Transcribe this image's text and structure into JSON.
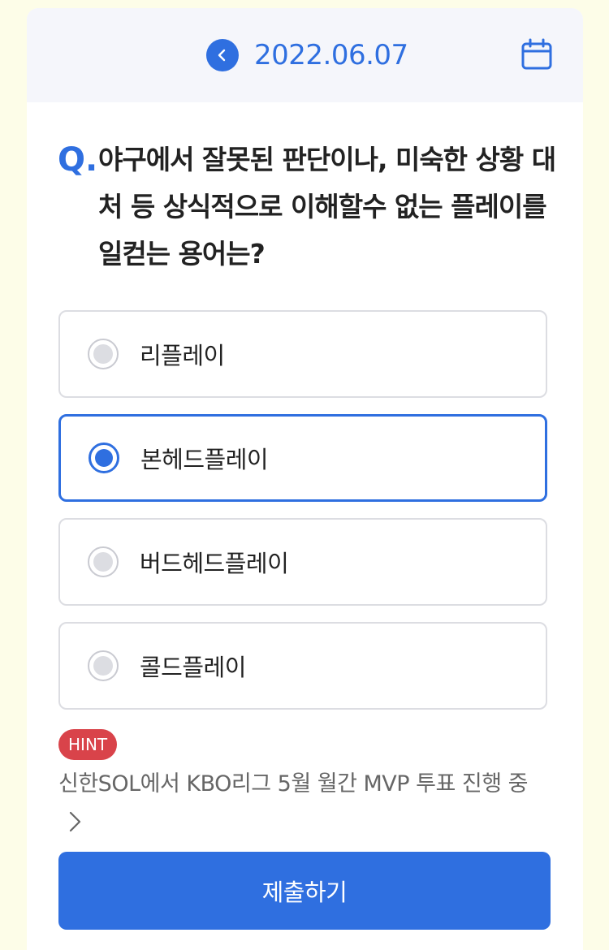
{
  "header": {
    "date": "2022.06.07",
    "back_icon": "chevron-left-icon",
    "calendar_icon": "calendar-icon"
  },
  "question": {
    "prefix": "Q.",
    "text": "야구에서 잘못된 판단이나, 미숙한 상황 대처 등 상식적으로 이해할수 없는 플레이를 일컫는 용어는?"
  },
  "options": [
    {
      "label": "리플레이",
      "selected": false
    },
    {
      "label": "본헤드플레이",
      "selected": true
    },
    {
      "label": "버드헤드플레이",
      "selected": false
    },
    {
      "label": "콜드플레이",
      "selected": false
    }
  ],
  "hint": {
    "badge": "HINT",
    "text": "신한SOL에서 KBO리그 5월 월간 MVP 투표 진행 중"
  },
  "submit_label": "제출하기",
  "colors": {
    "accent": "#2f6fe0",
    "hint": "#d9434a",
    "background": "#fdfde8"
  }
}
